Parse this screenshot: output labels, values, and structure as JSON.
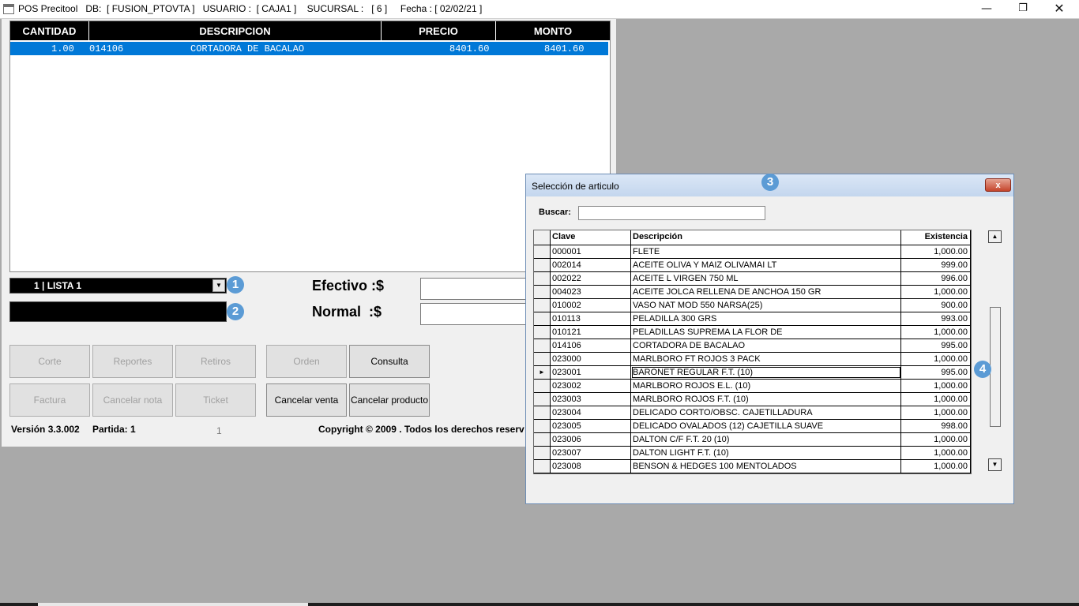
{
  "window": {
    "title": "POS Precitool   DB:  [ FUSION_PTOVTA ]   USUARIO :  [ CAJA1 ]    SUCURSAL :   [ 6 ]     Fecha : [ 02/02/21 ]"
  },
  "sales_grid": {
    "headers": {
      "cantidad": "CANTIDAD",
      "descripcion": "DESCRIPCION",
      "precio": "PRECIO",
      "monto": "MONTO"
    },
    "rows": [
      {
        "cantidad": "1.00",
        "clave": "014106",
        "descripcion": "CORTADORA DE BACALAO",
        "precio": "8401.60",
        "monto": "8401.60"
      }
    ]
  },
  "price_list": {
    "value": "1  | LISTA 1"
  },
  "payment": {
    "efectivo_label": "Efectivo :$",
    "normal_label": "Normal  :$"
  },
  "buttons": {
    "corte": "Corte",
    "reportes": "Reportes",
    "retiros": "Retiros",
    "orden": "Orden",
    "consulta": "Consulta",
    "factura": "Factura",
    "cancelar_nota": "Cancelar nota",
    "ticket": "Ticket",
    "cancelar_venta": "Cancelar venta",
    "cancelar_producto": "Cancelar producto"
  },
  "footer": {
    "version": "Versión 3.3.002",
    "partida": "Partida: 1",
    "count": "1",
    "copyright": "Copyright © 2009 . Todos los derechos reserv"
  },
  "badges": {
    "one": "1",
    "two": "2",
    "three": "3",
    "four": "4"
  },
  "dialog": {
    "title": "Selección de articulo",
    "close_label": "x",
    "search_label": "Buscar:",
    "search_value": "",
    "headers": {
      "clave": "Clave",
      "descripcion": "Descripción",
      "existencia": "Existencia"
    },
    "selected_pointer": "►",
    "rows": [
      {
        "clave": "000001",
        "descripcion": "FLETE",
        "existencia": "1,000.00"
      },
      {
        "clave": "002014",
        "descripcion": "ACEITE OLIVA Y MAIZ OLIVAMAI LT",
        "existencia": "999.00"
      },
      {
        "clave": "002022",
        "descripcion": "ACEITE L VIRGEN 750 ML",
        "existencia": "996.00"
      },
      {
        "clave": "004023",
        "descripcion": "ACEITE JOLCA RELLENA DE ANCHOA 150 GR",
        "existencia": "1,000.00"
      },
      {
        "clave": "010002",
        "descripcion": "VASO NAT MOD 550 NARSA(25)",
        "existencia": "900.00"
      },
      {
        "clave": "010113",
        "descripcion": "PELADILLA 300 GRS",
        "existencia": "993.00"
      },
      {
        "clave": "010121",
        "descripcion": "PELADILLAS SUPREMA LA FLOR DE",
        "existencia": "1,000.00"
      },
      {
        "clave": "014106",
        "descripcion": "CORTADORA DE BACALAO",
        "existencia": "995.00"
      },
      {
        "clave": "023000",
        "descripcion": "MARLBORO FT ROJOS 3 PACK",
        "existencia": "1,000.00"
      },
      {
        "clave": "023001",
        "descripcion": "BARONET REGULAR F.T. (10)",
        "existencia": "995.00"
      },
      {
        "clave": "023002",
        "descripcion": "MARLBORO ROJOS E.L. (10)",
        "existencia": "1,000.00"
      },
      {
        "clave": "023003",
        "descripcion": "MARLBORO ROJOS F.T. (10)",
        "existencia": "1,000.00"
      },
      {
        "clave": "023004",
        "descripcion": "DELICADO CORTO/OBSC. CAJETILLADURA",
        "existencia": "1,000.00"
      },
      {
        "clave": "023005",
        "descripcion": "DELICADO OVALADOS (12) CAJETILLA SUAVE",
        "existencia": "998.00"
      },
      {
        "clave": "023006",
        "descripcion": "DALTON C/F F.T. 20 (10)",
        "existencia": "1,000.00"
      },
      {
        "clave": "023007",
        "descripcion": "DALTON LIGHT F.T. (10)",
        "existencia": "1,000.00"
      },
      {
        "clave": "023008",
        "descripcion": "BENSON & HEDGES 100 MENTOLADOS",
        "existencia": "1,000.00"
      }
    ]
  }
}
